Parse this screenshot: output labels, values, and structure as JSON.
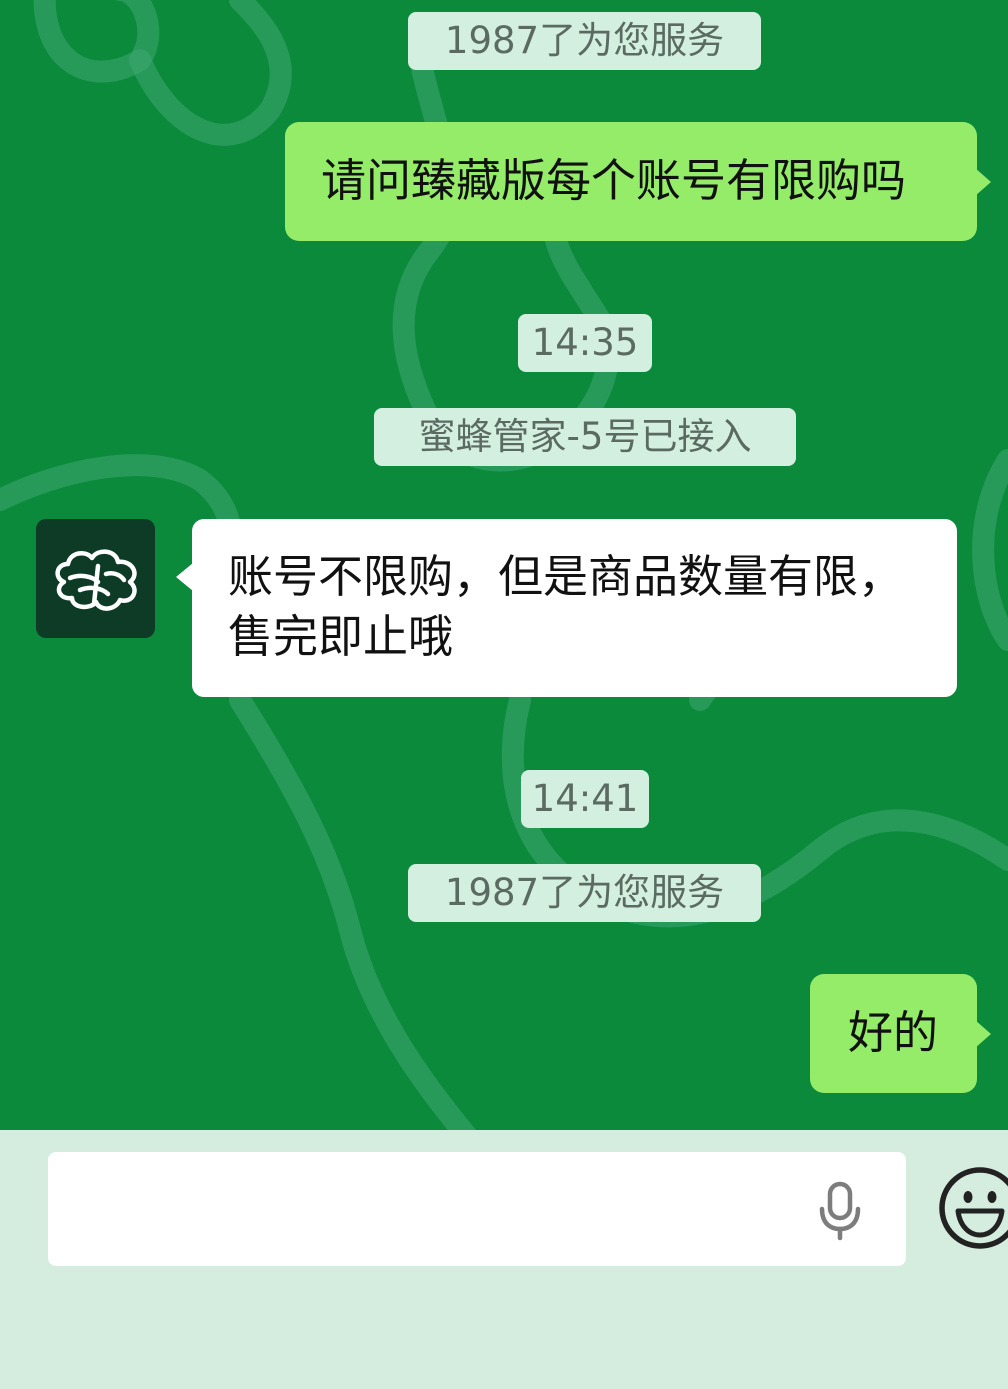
{
  "chat": {
    "messages": [
      {
        "type": "system",
        "text": "1987了为您服务"
      },
      {
        "type": "outgoing",
        "text": "请问臻藏版每个账号有限购吗"
      },
      {
        "type": "timestamp",
        "text": "14:35"
      },
      {
        "type": "system",
        "text": "蜜蜂管家-5号已接入"
      },
      {
        "type": "incoming",
        "sender": "bee-assistant",
        "lines": [
          "账号不限购，但是商品数量有限，",
          "售完即止哦"
        ]
      },
      {
        "type": "timestamp",
        "text": "14:41"
      },
      {
        "type": "system",
        "text": "1987了为您服务"
      },
      {
        "type": "outgoing",
        "text": "好的"
      }
    ]
  },
  "input_bar": {
    "value": "",
    "placeholder": "",
    "icons": {
      "voice": "microphone-icon",
      "emoji": "smiley-face-icon"
    }
  },
  "avatar": {
    "icon": "flower-logo-icon"
  },
  "colors": {
    "chat_background": "#0b8a3c",
    "outgoing_bubble": "#95ec69",
    "incoming_bubble": "#ffffff",
    "system_pill": "#d3efe0",
    "input_bar_background": "#d4eddf"
  }
}
